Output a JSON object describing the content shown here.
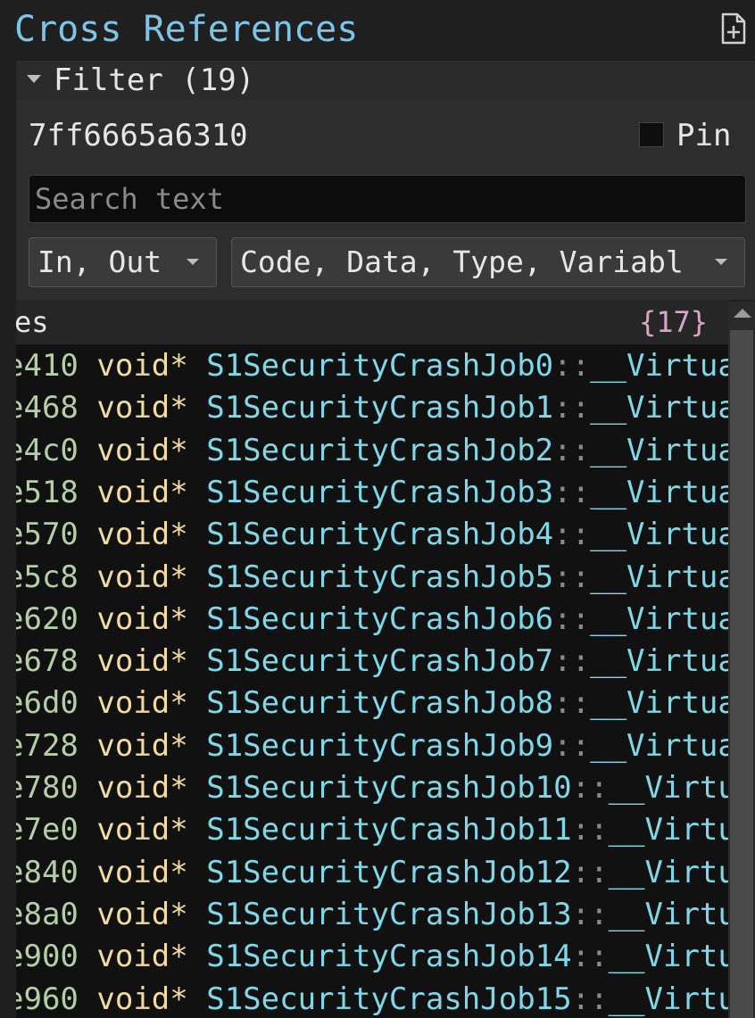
{
  "panel": {
    "title": "Cross References"
  },
  "filter": {
    "label": "Filter (19)",
    "address": "7ff6665a6310",
    "pin_label": "Pin",
    "pin_checked": false,
    "search_placeholder": "Search text",
    "direction_value": "In, Out",
    "type_value": "Code, Data, Type, Variabl"
  },
  "results": {
    "header_label": "es",
    "count": "{17}",
    "rows": [
      {
        "addr": "e410",
        "type": "void*",
        "symbol": "S1SecurityCrashJob0",
        "sep": "::",
        "member": "__Virtua"
      },
      {
        "addr": "e468",
        "type": "void*",
        "symbol": "S1SecurityCrashJob1",
        "sep": "::",
        "member": "__Virtua"
      },
      {
        "addr": "e4c0",
        "type": "void*",
        "symbol": "S1SecurityCrashJob2",
        "sep": "::",
        "member": "__Virtua"
      },
      {
        "addr": "e518",
        "type": "void*",
        "symbol": "S1SecurityCrashJob3",
        "sep": "::",
        "member": "__Virtua"
      },
      {
        "addr": "e570",
        "type": "void*",
        "symbol": "S1SecurityCrashJob4",
        "sep": "::",
        "member": "__Virtua"
      },
      {
        "addr": "e5c8",
        "type": "void*",
        "symbol": "S1SecurityCrashJob5",
        "sep": "::",
        "member": "__Virtua"
      },
      {
        "addr": "e620",
        "type": "void*",
        "symbol": "S1SecurityCrashJob6",
        "sep": "::",
        "member": "__Virtua"
      },
      {
        "addr": "e678",
        "type": "void*",
        "symbol": "S1SecurityCrashJob7",
        "sep": "::",
        "member": "__Virtua"
      },
      {
        "addr": "e6d0",
        "type": "void*",
        "symbol": "S1SecurityCrashJob8",
        "sep": "::",
        "member": "__Virtua"
      },
      {
        "addr": "e728",
        "type": "void*",
        "symbol": "S1SecurityCrashJob9",
        "sep": "::",
        "member": "__Virtua"
      },
      {
        "addr": "e780",
        "type": "void*",
        "symbol": "S1SecurityCrashJob10",
        "sep": "::",
        "member": "__Virtu"
      },
      {
        "addr": "e7e0",
        "type": "void*",
        "symbol": "S1SecurityCrashJob11",
        "sep": "::",
        "member": "__Virtu"
      },
      {
        "addr": "e840",
        "type": "void*",
        "symbol": "S1SecurityCrashJob12",
        "sep": "::",
        "member": "__Virtu"
      },
      {
        "addr": "e8a0",
        "type": "void*",
        "symbol": "S1SecurityCrashJob13",
        "sep": "::",
        "member": "__Virtu"
      },
      {
        "addr": "e900",
        "type": "void*",
        "symbol": "S1SecurityCrashJob14",
        "sep": "::",
        "member": "__Virtu"
      },
      {
        "addr": "e960",
        "type": "void*",
        "symbol": "S1SecurityCrashJob15",
        "sep": "::",
        "member": "__Virtu"
      }
    ]
  },
  "icons": {
    "new_pane": "new-document-plus-icon",
    "filter_toggle": "caret-down-icon",
    "dropdown": "chevron-down-icon",
    "scroll_up": "scroll-up-arrow-icon"
  },
  "colors": {
    "title": "#7cc4e8",
    "address": "#b5cea8",
    "type": "#f0dca0",
    "symbol": "#7fd8e8",
    "count": "#d4a8c4",
    "list_background": "#111111"
  }
}
